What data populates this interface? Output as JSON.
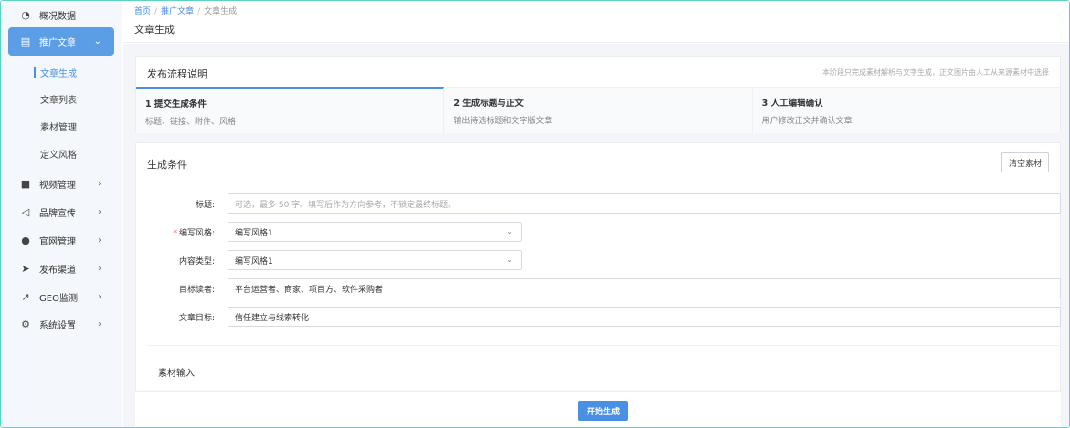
{
  "sidebar": {
    "items": [
      {
        "label": "概况数据",
        "icon": "dashboard-icon"
      },
      {
        "label": "推广文章",
        "icon": "document-icon",
        "active": true,
        "expanded": true
      },
      {
        "label": "视频管理",
        "icon": "video-icon"
      },
      {
        "label": "品牌宣传",
        "icon": "megaphone-icon"
      },
      {
        "label": "官网管理",
        "icon": "globe-icon"
      },
      {
        "label": "发布渠道",
        "icon": "send-icon"
      },
      {
        "label": "GEO监测",
        "icon": "line-chart-icon"
      },
      {
        "label": "系统设置",
        "icon": "gears-icon"
      }
    ],
    "sub_items": [
      {
        "label": "文章生成",
        "active": true
      },
      {
        "label": "文章列表"
      },
      {
        "label": "素材管理"
      },
      {
        "label": "定义风格"
      }
    ]
  },
  "breadcrumb": {
    "home": "首页",
    "section": "推广文章",
    "current": "文章生成"
  },
  "page_title": "文章生成",
  "process": {
    "title": "发布流程说明",
    "note": "本阶段只完成素材解析与文字生成，正文图片由人工从来源素材中选择",
    "steps": [
      {
        "title": "1 提交生成条件",
        "desc": "标题、链接、附件、风格"
      },
      {
        "title": "2 生成标题与正文",
        "desc": "输出待选标题和文字版文章"
      },
      {
        "title": "3 人工编辑确认",
        "desc": "用户修改正文并确认文章"
      }
    ]
  },
  "form": {
    "title": "生成条件",
    "clear_label": "清空素材",
    "fields": {
      "title_label": "标题:",
      "title_placeholder": "可选，最多 50 字。填写后作为方向参考，不锁定最终标题。",
      "style_required": "*",
      "style_label": "编写风格:",
      "style_value": "编写风格1",
      "content_type_label": "内容类型:",
      "content_type_value": "编写风格1",
      "audience_label": "目标读者:",
      "audience_value": "平台运营者、商家、项目方、软件采购者",
      "goal_label": "文章目标:",
      "goal_value": "信任建立与线索转化"
    },
    "material_label": "素材输入"
  },
  "actions": {
    "start_label": "开始生成"
  },
  "colors": {
    "accent": "#4a90e2",
    "active_nav": "#5b9ee6",
    "required": "#e54545"
  }
}
